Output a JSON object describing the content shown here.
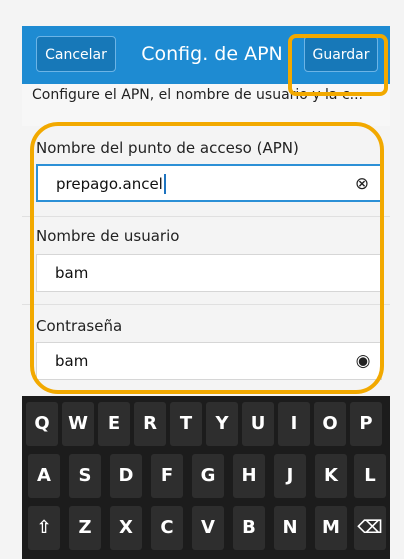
{
  "titlebar": {
    "cancel_label": "Cancelar",
    "title": "Config. de APN",
    "save_label": "Guardar"
  },
  "description": "Configure el APN, el nombre de usuario y la c...",
  "form": {
    "apn": {
      "label": "Nombre del punto de acceso (APN)",
      "value": "prepago.ancel",
      "icon": "clear-icon"
    },
    "username": {
      "label": "Nombre de usuario",
      "value": "bam"
    },
    "password": {
      "label": "Contraseña",
      "value": "bam",
      "icon": "eye-icon"
    }
  },
  "keyboard": {
    "row1": [
      "Q",
      "W",
      "E",
      "R",
      "T",
      "Y",
      "U",
      "I",
      "O",
      "P"
    ],
    "row2": [
      "A",
      "S",
      "D",
      "F",
      "G",
      "H",
      "J",
      "K",
      "L"
    ],
    "row3_shift": "⇧",
    "row3": [
      "Z",
      "X",
      "C",
      "V",
      "B",
      "N",
      "M"
    ],
    "row3_backspace": "⌫"
  },
  "colors": {
    "titlebar": "#1e8bd2",
    "highlight": "#f2a900",
    "keyboard": "#1c1c1c"
  }
}
